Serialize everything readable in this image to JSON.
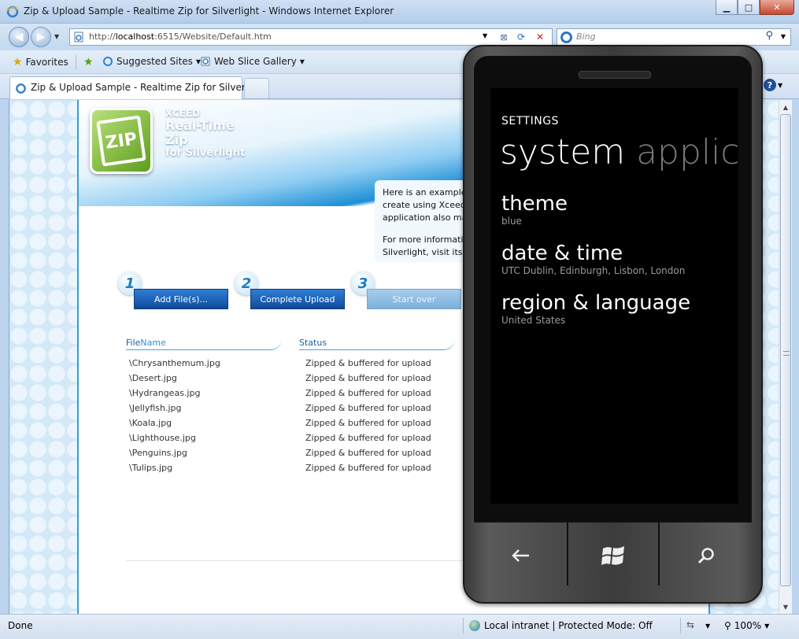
{
  "window": {
    "title": "Zip & Upload Sample - Realtime Zip for Silverlight - Windows Internet Explorer",
    "min_icon": "minimize-icon",
    "max_icon": "maximize-icon",
    "close_icon": "close-icon"
  },
  "addressbar": {
    "url_prefix": "http://",
    "url_host": "localhost",
    "url_rest": ":6515/Website/Default.htm",
    "search_placeholder": "Bing"
  },
  "favorites": {
    "favorites_label": "Favorites",
    "suggested_label": "Suggested Sites",
    "webslice_label": "Web Slice Gallery"
  },
  "tabs": [
    {
      "label": "Zip & Upload Sample - Realtime Zip for Silverlight"
    }
  ],
  "page": {
    "brand": {
      "line1": "XCEED",
      "line2": "Real-Time",
      "line3": "Zip",
      "line4": "for Silverlight"
    },
    "logo_text": "ZIP",
    "info": {
      "para1_line1": "Here is an example",
      "para1_line2": "create using Xceed",
      "para1_line3": "application also ma",
      "para2_line1": "For more informati",
      "para2_line2": "Silverlight, visit its"
    },
    "steps": [
      {
        "num": "1",
        "label": "Add File(s)..."
      },
      {
        "num": "2",
        "label": "Complete Upload"
      },
      {
        "num": "3",
        "label": "Start over"
      }
    ],
    "columns": {
      "file_a": "File",
      "file_b": "Name",
      "status": "Status"
    },
    "files": [
      {
        "name": "\\Chrysanthemum.jpg",
        "status": "Zipped & buffered for upload"
      },
      {
        "name": "\\Desert.jpg",
        "status": "Zipped & buffered for upload"
      },
      {
        "name": "\\Hydrangeas.jpg",
        "status": "Zipped & buffered for upload"
      },
      {
        "name": "\\Jellyfish.jpg",
        "status": "Zipped & buffered for upload"
      },
      {
        "name": "\\Koala.jpg",
        "status": "Zipped & buffered for upload"
      },
      {
        "name": "\\Lighthouse.jpg",
        "status": "Zipped & buffered for upload"
      },
      {
        "name": "\\Penguins.jpg",
        "status": "Zipped & buffered for upload"
      },
      {
        "name": "\\Tulips.jpg",
        "status": "Zipped & buffered for upload"
      }
    ]
  },
  "statusbar": {
    "done": "Done",
    "zone": "Local intranet | Protected Mode: Off",
    "zoom": "100%"
  },
  "phone": {
    "app_title": "SETTINGS",
    "pivot_active": "system",
    "pivot_inactive": "applicat",
    "settings": [
      {
        "name": "theme",
        "value": "blue"
      },
      {
        "name": "date & time",
        "value": "UTC Dublin, Edinburgh, Lisbon, London"
      },
      {
        "name": "region & language",
        "value": "United States"
      }
    ]
  },
  "colors": {
    "accent_blue": "#1d8ed6",
    "button_blue": "#0f4b9a",
    "phone_bg": "#000000"
  }
}
